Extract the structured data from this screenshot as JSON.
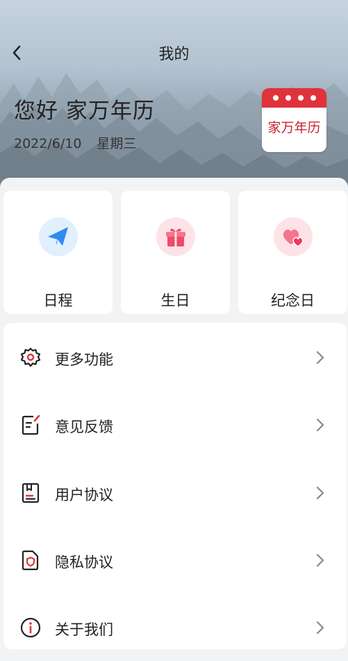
{
  "header": {
    "title": "我的",
    "greeting": "您好 家万年历",
    "date": "2022/6/10",
    "weekday": "星期三",
    "logo_text": "家万年历"
  },
  "quick_actions": [
    {
      "label": "日程",
      "icon": "paper-plane-icon",
      "color": "#2f8cf0"
    },
    {
      "label": "生日",
      "icon": "gift-icon",
      "color": "#ef4a68"
    },
    {
      "label": "纪念日",
      "icon": "hearts-icon",
      "color": "#ef4a68"
    }
  ],
  "menu": [
    {
      "label": "更多功能",
      "icon": "gear-icon"
    },
    {
      "label": "意见反馈",
      "icon": "feedback-icon"
    },
    {
      "label": "用户协议",
      "icon": "agreement-icon"
    },
    {
      "label": "隐私协议",
      "icon": "privacy-shield-icon"
    },
    {
      "label": "关于我们",
      "icon": "info-icon"
    }
  ],
  "colors": {
    "accent": "#e0323a",
    "background": "#f2f3f5",
    "card": "#ffffff"
  }
}
